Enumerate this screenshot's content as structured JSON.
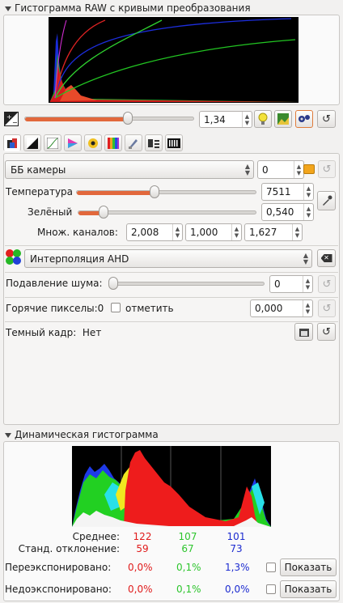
{
  "raw_histogram": {
    "title": "Гистограмма RAW с кривыми преобразования"
  },
  "exposure": {
    "value": "1,34",
    "slider_fraction": 0.62,
    "buttons": [
      "bulb-icon",
      "image-icon",
      "gears-icon",
      "reset-icon"
    ]
  },
  "tabs": [
    "exposure-tab",
    "bw-tab",
    "curves-tab",
    "color-tab",
    "lens-tab",
    "gradient-tab",
    "brush-tab",
    "meta-tab",
    "raw-tab"
  ],
  "white_balance": {
    "method": "ББ камеры",
    "method_value": "0",
    "temperature_label": "Температура",
    "temperature_value": "7511",
    "temperature_fraction": 0.55,
    "green_label": "Зелёный",
    "green_value": "0,540",
    "green_fraction": 0.09
  },
  "channel_mult": {
    "label": "Множ. каналов:",
    "r": "2,008",
    "g": "1,000",
    "b": "1,627"
  },
  "demosaic": {
    "method": "Интерполяция AHD"
  },
  "noise": {
    "label": "Подавление шума:",
    "value": "0",
    "fraction": 0.0
  },
  "hot_pixels": {
    "label": "Горячие пикселы:0",
    "checkbox_label": "отметить",
    "checked": false,
    "value": "0,000"
  },
  "dark_frame": {
    "label": "Темный кадр:",
    "value": "Нет"
  },
  "dynamic_histogram": {
    "title": "Динамическая гистограмма",
    "mean_label": "Среднее:",
    "stddev_label": "Станд. отклонение:",
    "mean": [
      "122",
      "107",
      "101"
    ],
    "stddev": [
      "59",
      "67",
      "73"
    ],
    "overexposed_label": "Переэкспонировано:",
    "underexposed_label": "Недоэкспонировано:",
    "overexposed": [
      "0,0%",
      "0,1%",
      "1,3%"
    ],
    "underexposed": [
      "0,0%",
      "0,1%",
      "0,0%"
    ],
    "show_label": "Показать",
    "colors": {
      "red": "#e01b1b",
      "green": "#2dc52d",
      "blue": "#1c2bd0"
    }
  }
}
